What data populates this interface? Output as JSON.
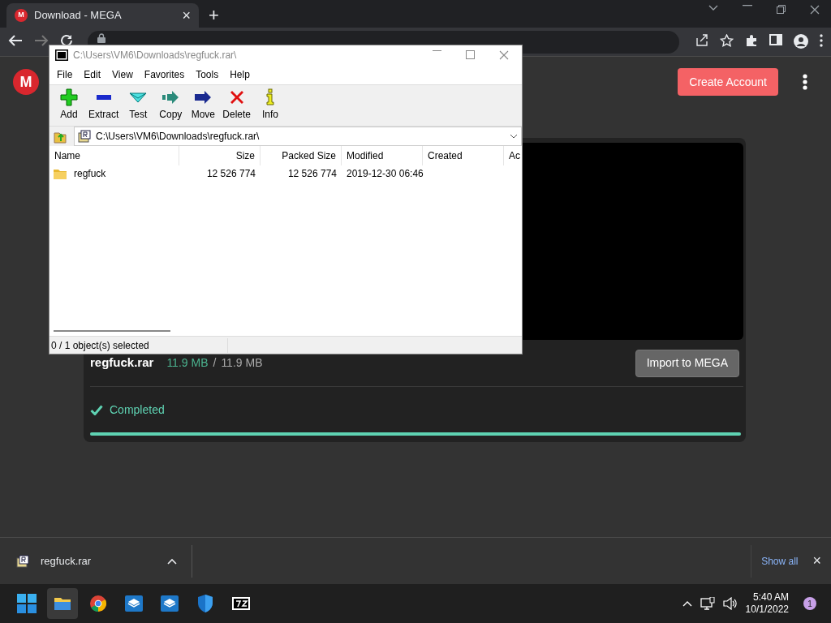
{
  "browser": {
    "tab": {
      "favicon": "M",
      "title": "Download - MEGA",
      "close": "×",
      "new_tab": "+"
    },
    "page": {
      "logo": "M",
      "create_account": "Create Account",
      "file_name": "regfuck.rar",
      "downloaded": "11.9 MB",
      "separator": "/",
      "total": "11.9 MB",
      "import_button": "Import to MEGA",
      "status": "Completed",
      "level": 1
    },
    "download_shelf": {
      "file": "regfuck.rar",
      "show_all": "Show all",
      "close": "×"
    }
  },
  "archive_window": {
    "title": "C:\\Users\\VM6\\Downloads\\regfuck.rar\\",
    "menu": [
      "File",
      "Edit",
      "View",
      "Favorites",
      "Tools",
      "Help"
    ],
    "toolbar": [
      {
        "kind": "add",
        "label": "Add"
      },
      {
        "kind": "extract",
        "label": "Extract"
      },
      {
        "kind": "test",
        "label": "Test"
      },
      {
        "kind": "copy",
        "label": "Copy"
      },
      {
        "kind": "move",
        "label": "Move"
      },
      {
        "kind": "delete",
        "label": "Delete"
      },
      {
        "kind": "info",
        "label": "Info"
      }
    ],
    "path": "C:\\Users\\VM6\\Downloads\\regfuck.rar\\",
    "columns": [
      "Name",
      "Size",
      "Packed Size",
      "Modified",
      "Created",
      "Ac"
    ],
    "rows": [
      {
        "cells": [
          "regfuck",
          "12 526 774",
          "12 526 774",
          "2019-12-30 06:46"
        ],
        "selected": false
      }
    ],
    "status": "0 / 1 object(s) selected"
  },
  "taskbar": {
    "apps": [
      {
        "kind": "explorer",
        "selected": true
      },
      {
        "kind": "chrome",
        "selected": false
      },
      {
        "kind": "sandbox",
        "selected": false
      },
      {
        "kind": "sandbox",
        "selected": false
      },
      {
        "kind": "shield",
        "selected": false
      },
      {
        "kind": "sevenzip",
        "selected": false
      }
    ],
    "time": "5:40 AM",
    "date": "10/1/2022",
    "notifications": "1"
  }
}
